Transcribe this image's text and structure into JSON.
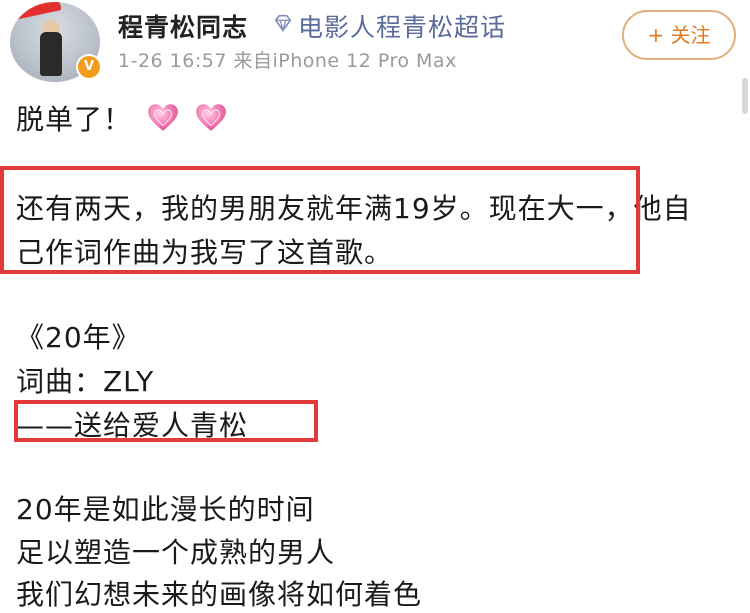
{
  "post": {
    "username": "程青松同志",
    "supertopic": "电影人程青松超话",
    "meta": "1-26 16:57  来自iPhone 12 Pro Max",
    "follow_label": "+ 关注",
    "verified_badge": "V"
  },
  "body": {
    "line1": "脱单了！",
    "line2": "还有两天，我的男朋友就年满19岁。现在大一，他自",
    "line3": "己作词作曲为我写了这首歌。",
    "song_title": "《20年》",
    "credits": "词曲：ZLY",
    "dedication": "——送给爱人青松",
    "lyric1": "20年是如此漫长的时间",
    "lyric2": "足以塑造一个成熟的男人",
    "lyric3": "我们幻想未来的画像将如何着色"
  },
  "icons": {
    "heart": "heart-icon",
    "diamond": "diamond-icon"
  },
  "colors": {
    "highlight": "#e23a3a",
    "heart": "#f07ab0",
    "supertopic": "#5b6b9a",
    "follow": "#e07a20"
  }
}
